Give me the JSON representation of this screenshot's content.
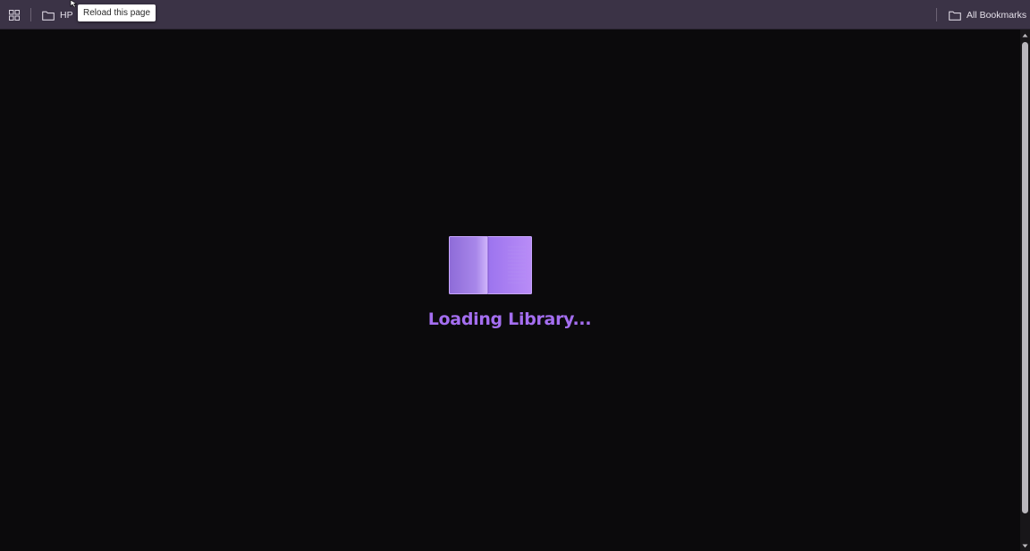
{
  "bookmarks_bar": {
    "items": [
      {
        "label": "HP",
        "icon": "folder-icon"
      }
    ],
    "hidden_tail_text": "t",
    "all_bookmarks": {
      "label": "All Bookmarks",
      "icon": "folder-icon"
    }
  },
  "tooltip": {
    "text": "Reload this page"
  },
  "loading": {
    "text": "Loading Library...",
    "icon": "open-book-icon",
    "accent_color": "#a46ef0"
  },
  "colors": {
    "toolbar_bg": "#3b3346",
    "page_bg": "#0b0a0c",
    "book_left": "#a07ae6",
    "book_right": "#b486f5"
  }
}
